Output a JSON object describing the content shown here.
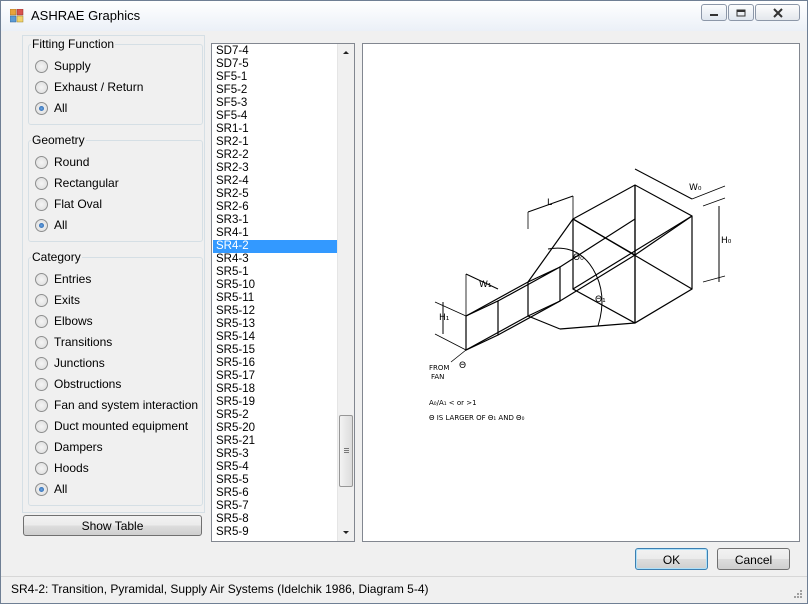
{
  "window": {
    "title": "ASHRAE Graphics"
  },
  "fitting_function": {
    "title": "Fitting Function",
    "options": [
      {
        "label": "Supply",
        "checked": false
      },
      {
        "label": "Exhaust / Return",
        "checked": false
      },
      {
        "label": "All",
        "checked": true
      }
    ]
  },
  "geometry": {
    "title": "Geometry",
    "options": [
      {
        "label": "Round",
        "checked": false
      },
      {
        "label": "Rectangular",
        "checked": false
      },
      {
        "label": "Flat Oval",
        "checked": false
      },
      {
        "label": "All",
        "checked": true
      }
    ]
  },
  "category": {
    "title": "Category",
    "options": [
      {
        "label": "Entries",
        "checked": false
      },
      {
        "label": "Exits",
        "checked": false
      },
      {
        "label": "Elbows",
        "checked": false
      },
      {
        "label": "Transitions",
        "checked": false
      },
      {
        "label": "Junctions",
        "checked": false
      },
      {
        "label": "Obstructions",
        "checked": false
      },
      {
        "label": "Fan and system interaction",
        "checked": false
      },
      {
        "label": "Duct mounted equipment",
        "checked": false
      },
      {
        "label": "Dampers",
        "checked": false
      },
      {
        "label": "Hoods",
        "checked": false
      },
      {
        "label": "All",
        "checked": true
      }
    ]
  },
  "show_table_label": "Show Table",
  "fitting_list": {
    "items": [
      "SD7-4",
      "SD7-5",
      "SF5-1",
      "SF5-2",
      "SF5-3",
      "SF5-4",
      "SR1-1",
      "SR2-1",
      "SR2-2",
      "SR2-3",
      "SR2-4",
      "SR2-5",
      "SR2-6",
      "SR3-1",
      "SR4-1",
      "SR4-2",
      "SR4-3",
      "SR5-1",
      "SR5-10",
      "SR5-11",
      "SR5-12",
      "SR5-13",
      "SR5-14",
      "SR5-15",
      "SR5-16",
      "SR5-17",
      "SR5-18",
      "SR5-19",
      "SR5-2",
      "SR5-20",
      "SR5-21",
      "SR5-3",
      "SR5-4",
      "SR5-5",
      "SR5-6",
      "SR5-7",
      "SR5-8",
      "SR5-9"
    ],
    "selected": "SR4-2"
  },
  "diagram": {
    "labels": {
      "l": "L",
      "w0": "W₀",
      "h0": "H₀",
      "w1": "W₁",
      "h1": "H₁",
      "theta0": "Θ₀",
      "theta1": "Θ₁",
      "theta": "Θ",
      "from": "FROM",
      "fan": "FAN",
      "note1": "A₀/A₁ < or >1",
      "note2": "Θ IS LARGER OF Θ₁ AND Θ₀"
    }
  },
  "buttons": {
    "ok": "OK",
    "cancel": "Cancel"
  },
  "status": {
    "text": "SR4-2: Transition, Pyramidal, Supply Air Systems (Idelchik 1986, Diagram 5-4)"
  },
  "colors": {
    "selection": "#3399ff",
    "window_bg": "#f0f0f0"
  }
}
